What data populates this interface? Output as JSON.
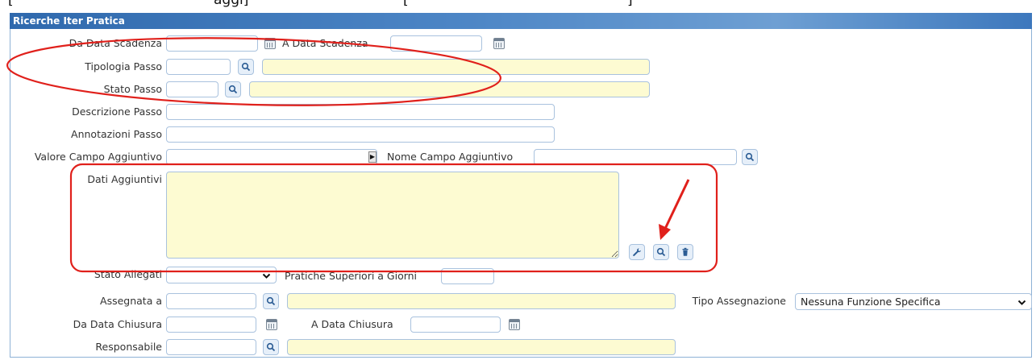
{
  "top_fragment": {
    "left": "[",
    "middle": "aggi]",
    "right": "[",
    "right_end": "]"
  },
  "panel": {
    "title": "Ricerche Iter Pratica"
  },
  "labels": {
    "da_data_scadenza": "Da Data Scadenza",
    "a_data_scadenza": "A Data Scadenza",
    "tipologia_passo": "Tipologia Passo",
    "stato_passo": "Stato Passo",
    "descrizione_passo": "Descrizione Passo",
    "annotazioni_passo": "Annotazioni Passo",
    "valore_campo_aggiuntivo": "Valore Campo Aggiuntivo",
    "nome_campo_aggiuntivo": "Nome Campo Aggiuntivo",
    "dati_aggiuntivi": "Dati Aggiuntivi",
    "stato_allegati": "Stato Allegati",
    "pratiche_superiori": "Pratiche Superiori a Giorni",
    "assegnata_a": "Assegnata a",
    "tipo_assegnazione": "Tipo Assegnazione",
    "da_data_chiusura": "Da Data Chiusura",
    "a_data_chiusura": "A Data Chiusura",
    "responsabile": "Responsabile"
  },
  "values": {
    "tipo_assegnazione": "Nessuna Funzione Specifica",
    "stato_allegati": ""
  },
  "icons": [
    "calendar-icon",
    "search-icon",
    "wrench-icon",
    "trash-icon",
    "chevron-down-icon",
    "triangle-right-icon"
  ],
  "colors": {
    "header": "#3f79bd",
    "readonly_field": "#fdfbd2",
    "annotation": "#e0201b",
    "border": "#a9c2de"
  }
}
